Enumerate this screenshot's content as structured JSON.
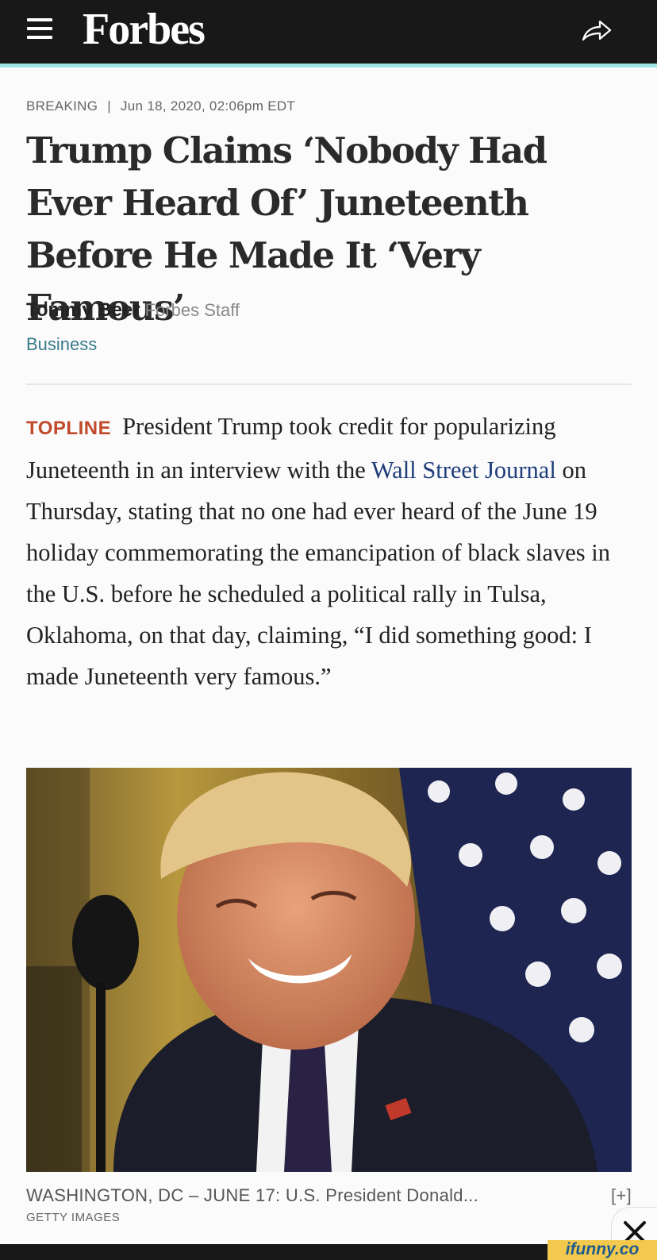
{
  "header": {
    "logo": "Forbes",
    "menu_icon": "hamburger-menu-icon",
    "share_icon": "share-arrow-icon",
    "accent_color": "#9ee4e2"
  },
  "article": {
    "label": "BREAKING",
    "separator": "|",
    "date": "Jun 18, 2020, 02:06pm EDT",
    "headline": "Trump Claims ‘Nobody Had Ever Heard Of’ Juneteenth Before He Made It ‘Very Famous’",
    "author": "Tommy Beer",
    "author_role": "Forbes Staff",
    "section": "Business"
  },
  "topline": {
    "label": "TOPLINE",
    "text_before": "President Trump took credit for popularizing Juneteenth in an interview with the ",
    "link": "Wall Street Journal",
    "text_after": " on Thursday, stating that no one had ever heard of the June 19 holiday commemorating the emancipation of black slaves in the U.S. before he scheduled a political rally in Tulsa, Oklahoma, on that day, claiming, “I did something good: I made Juneteenth very famous.”"
  },
  "photo": {
    "caption": "WASHINGTON, DC – JUNE 17: U.S. President Donald...",
    "expand": "[+]",
    "credit": "GETTY IMAGES"
  },
  "overlay": {
    "close_icon": "close-x-icon",
    "watermark": "ifunny.co"
  },
  "colors": {
    "topline_label": "#c14a2c",
    "link": "#1f3d7a",
    "section": "#3a7a8a"
  }
}
